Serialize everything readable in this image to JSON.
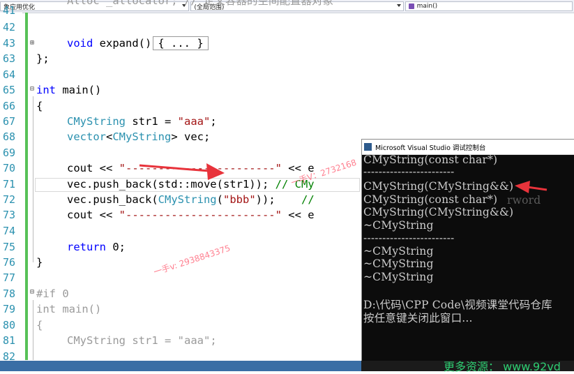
{
  "toolbar": {
    "project_combo": "象应用优化",
    "scope_combo": "(全局范围)",
    "function_combo": "main()"
  },
  "line_numbers": [
    "41",
    "42",
    "43",
    "63",
    "64",
    "65",
    "66",
    "67",
    "68",
    "69",
    "70",
    "71",
    "72",
    "73",
    "74",
    "75",
    "76",
    "77",
    "78",
    "79",
    "80",
    "81",
    "82"
  ],
  "code": {
    "l41": "Alloc _allocator; // 定义容器的空间配置器对象",
    "l43_kw": "void",
    "l43_fn": " expand()",
    "l43_box": "{ ... }",
    "l63": "};",
    "l65_kw": "int",
    "l65_rest": " main()",
    "l66": "{",
    "l67_type": "CMyString",
    "l67_mid": " str1 = ",
    "l67_str": "\"aaa\"",
    "l67_end": ";",
    "l68_type": "vector",
    "l68_lt": "<",
    "l68_type2": "CMyString",
    "l68_rest": "> vec;",
    "l70_a": "cout << ",
    "l70_str": "\"-----------------------\"",
    "l70_b": " << e",
    "l71_a": "vec.push_back(std::move(str1)); ",
    "l71_cm": "// CMy",
    "l72_a": "vec.push_back(",
    "l72_type": "CMyString",
    "l72_b": "(",
    "l72_str": "\"bbb\"",
    "l72_c": "));    ",
    "l72_cm": "//",
    "l73_a": "cout << ",
    "l73_str": "\"-----------------------\"",
    "l73_b": " << e",
    "l75_kw": "return",
    "l75_rest": " 0;",
    "l76": "}",
    "l78": "#if 0",
    "l79_kw": "int",
    "l79_rest": " main()",
    "l80": "{",
    "l81_type": "CMyString",
    "l81_mid": " str1 = ",
    "l81_str": "\"aaa\"",
    "l81_end": ";"
  },
  "console": {
    "title": "Microsoft Visual Studio 调试控制台",
    "lines": [
      "CMyString(const char*)",
      "------------------------",
      "CMyString(CMyString&&)",
      "CMyString(const char*)",
      "CMyString(CMyString&&)",
      "~CMyString",
      "------------------------",
      "~CMyString",
      "~CMyString",
      "~CMyString",
      "",
      "D:\\代码\\CPP Code\\视频课堂代码仓库",
      "按任意键关闭此窗口..."
    ],
    "overlap_text": "rword"
  },
  "watermarks": {
    "wm1": "一手V：2732168",
    "wm2": "一手v: 2938843375"
  },
  "promo": "更多资源： www.92vd",
  "colors": {
    "keyword": "#0000ff",
    "type": "#2b91af",
    "string": "#a31515",
    "comment": "#008000",
    "arrow": "#e8333b",
    "console_bg": "#0c0c0c"
  }
}
